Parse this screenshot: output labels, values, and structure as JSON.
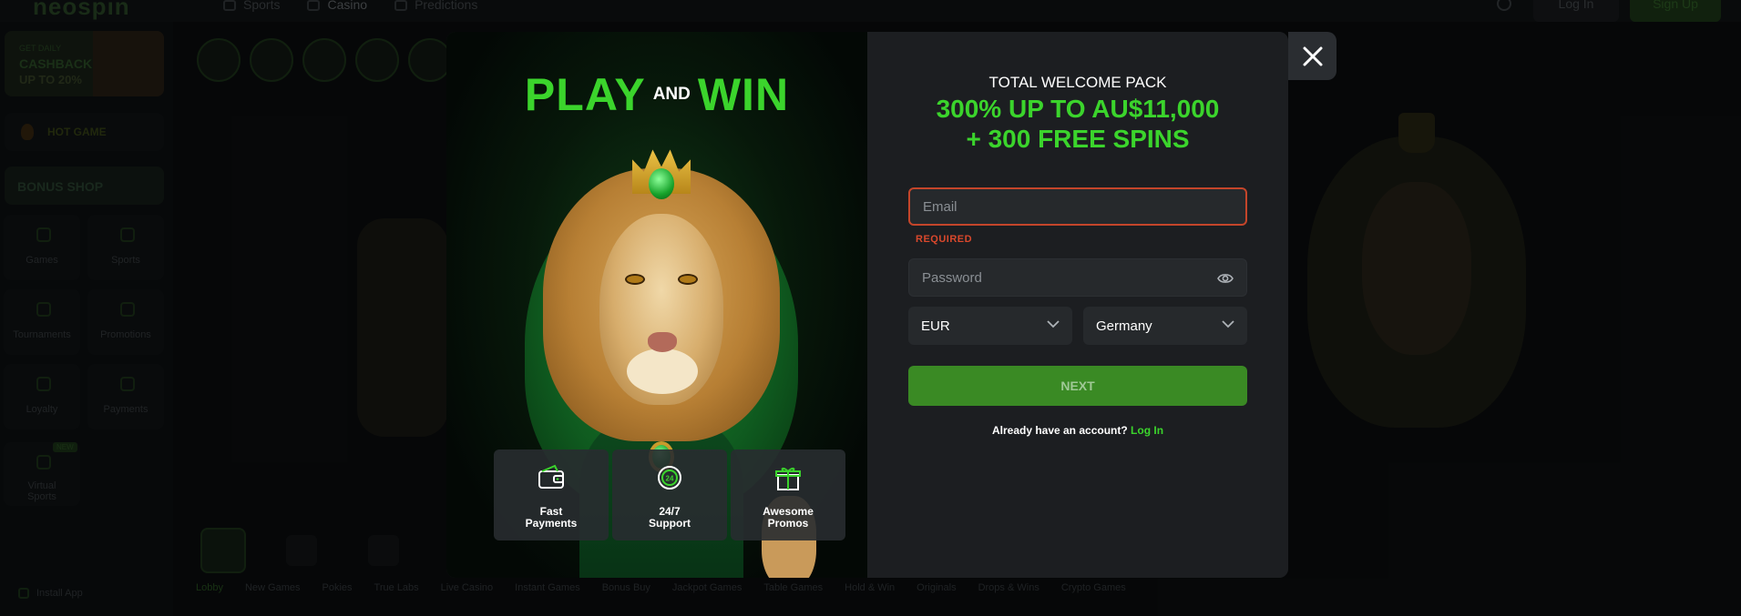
{
  "background": {
    "logo": "neospin",
    "topnav": [
      "Sports",
      "Casino",
      "Predictions"
    ],
    "login_label": "Log In",
    "signup_label": "Sign Up",
    "cashback": {
      "small": "GET DAILY",
      "big": "CASHBACK",
      "sub": "UP TO 20%"
    },
    "hot_game": "HOT GAME",
    "bonus_shop": "BONUS SHOP",
    "tiles": [
      "Games",
      "Sports",
      "Tournaments",
      "Promotions",
      "Loyalty",
      "Payments",
      "Virtual\nSports"
    ],
    "new_badge": "NEW",
    "install_app": "Install App",
    "categories": [
      "Lobby",
      "New Games",
      "Pokies",
      "True Labs",
      "Live Casino",
      "Instant Games",
      "Bonus Buy",
      "Jackpot Games",
      "Table Games",
      "Hold & Win",
      "Originals",
      "Drops & Wins",
      "Crypto Games"
    ]
  },
  "promo": {
    "play": "PLAY",
    "and": "AND",
    "win": "WIN",
    "features": [
      {
        "icon": "wallet-icon",
        "label": "Fast\nPayments"
      },
      {
        "icon": "support-24-icon",
        "label": "24/7\nSupport"
      },
      {
        "icon": "gift-icon",
        "label": "Awesome\nPromos"
      }
    ]
  },
  "form": {
    "title": "TOTAL WELCOME PACK",
    "offer": "300% UP TO AU$11,000\n+ 300 FREE SPINS",
    "email_placeholder": "Email",
    "email_value": "",
    "required_label": "REQUIRED",
    "password_placeholder": "Password",
    "password_value": "",
    "currency": "EUR",
    "country": "Germany",
    "next_label": "NEXT",
    "account_text": "Already have an account?",
    "login_link": "Log In"
  },
  "colors": {
    "accent_green": "#3bd42c",
    "error_red": "#d9482c",
    "button_green": "#3a8a24",
    "modal_bg": "#1c1e21"
  }
}
